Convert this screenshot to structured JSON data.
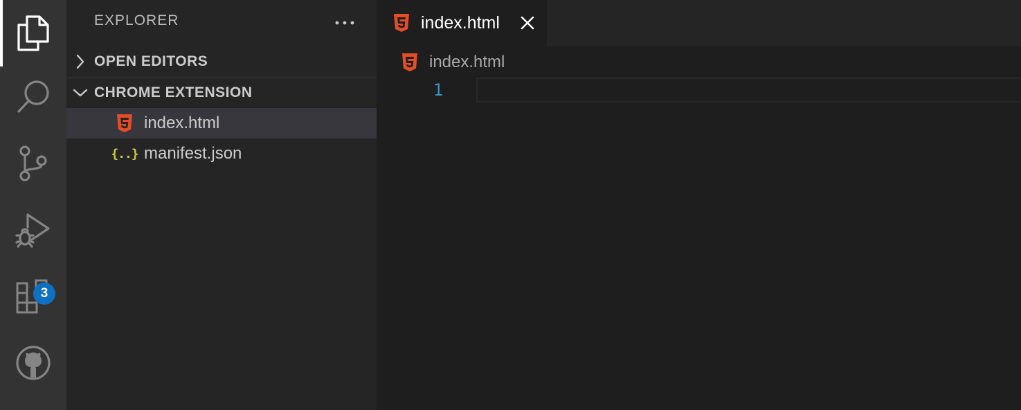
{
  "activity_bar": {
    "items": [
      {
        "icon": "files-icon",
        "active": true
      },
      {
        "icon": "search-icon"
      },
      {
        "icon": "source-control-icon"
      },
      {
        "icon": "run-debug-icon"
      },
      {
        "icon": "extensions-icon",
        "badge": "3"
      },
      {
        "icon": "github-icon"
      }
    ],
    "badge_color": "#0e70c0"
  },
  "sidebar": {
    "title": "EXPLORER",
    "more_actions_icon": "ellipsis-icon",
    "sections": [
      {
        "label": "OPEN EDITORS",
        "expanded": false
      },
      {
        "label": "CHROME EXTENSION",
        "expanded": true
      }
    ],
    "files": [
      {
        "name": "index.html",
        "icon": "html5-icon",
        "selected": true
      },
      {
        "name": "manifest.json",
        "icon": "json-icon",
        "icon_text": "{..}"
      }
    ]
  },
  "editor": {
    "tab": {
      "label": "index.html",
      "icon": "html5-icon",
      "close_icon": "close-icon"
    },
    "breadcrumb": {
      "label": "index.html",
      "icon": "html5-icon"
    },
    "lines": [
      {
        "number": "1",
        "content": ""
      }
    ]
  },
  "colors": {
    "activity_bar_bg": "#333333",
    "sidebar_bg": "#252526",
    "editor_bg": "#1e1e1e",
    "html_icon": "#e44d26",
    "json_icon": "#cbcb41",
    "line_number": "#3794c0"
  }
}
